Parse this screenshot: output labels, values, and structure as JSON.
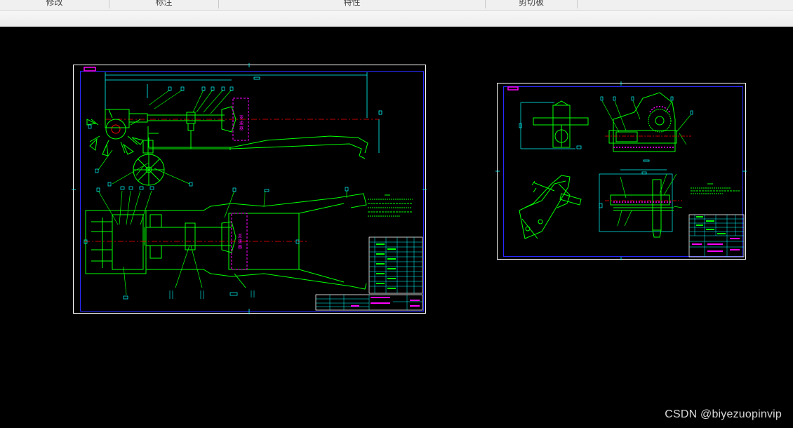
{
  "ribbon": {
    "groups": [
      {
        "label": "修改"
      },
      {
        "label": "标注"
      },
      {
        "label": "特性"
      },
      {
        "label": "剪切板"
      }
    ]
  },
  "drawing": {
    "sheet1": {
      "marker_text_1": "变 速 器",
      "marker_text_2": "变 速 器"
    }
  },
  "watermark": "CSDN @biyezuopinvip",
  "colors": {
    "background": "#000000",
    "sheet_border": "#ffffff",
    "frame": "#2a2aff",
    "geometry": "#00ff00",
    "dimension": "#00ffff",
    "highlight": "#ff00ff",
    "centerline": "#ff0000"
  }
}
